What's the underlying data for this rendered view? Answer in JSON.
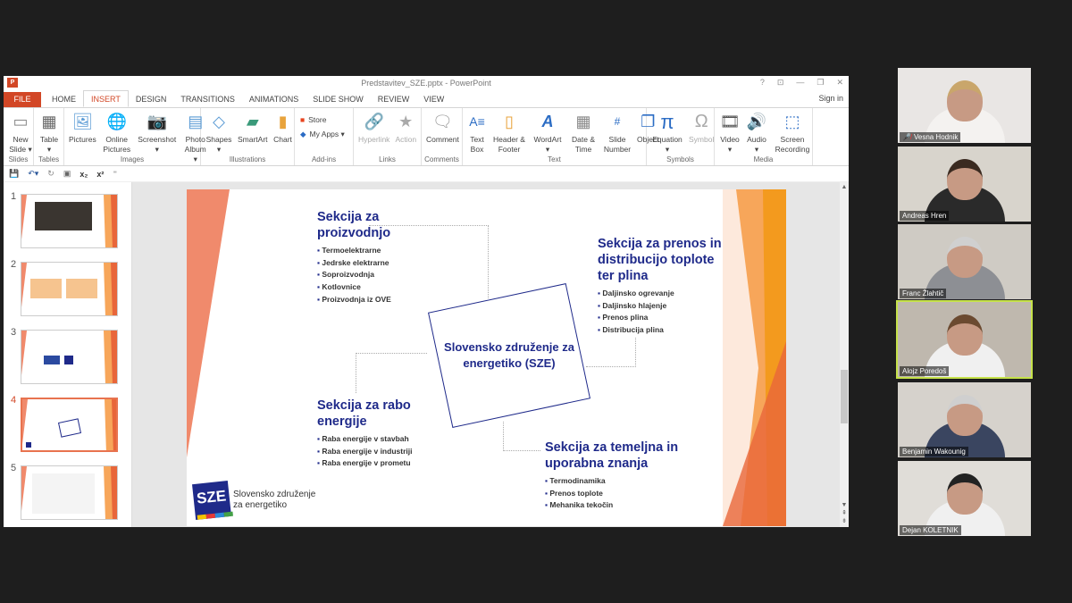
{
  "window": {
    "title": "Predstavitev_SZE.pptx - PowerPoint",
    "app_icon": "P",
    "controls": [
      "?",
      "⊡",
      "—",
      "❐",
      "✕"
    ],
    "sign_in": "Sign in"
  },
  "tabs": [
    {
      "label": "FILE"
    },
    {
      "label": "HOME"
    },
    {
      "label": "INSERT",
      "active": true
    },
    {
      "label": "DESIGN"
    },
    {
      "label": "TRANSITIONS"
    },
    {
      "label": "ANIMATIONS"
    },
    {
      "label": "SLIDE SHOW"
    },
    {
      "label": "REVIEW"
    },
    {
      "label": "VIEW"
    }
  ],
  "ribbon": {
    "slides": {
      "label": "Slides",
      "new_slide": "New Slide ▾"
    },
    "tables": {
      "label": "Tables",
      "table": "Table ▾"
    },
    "images": {
      "label": "Images",
      "pictures": "Pictures",
      "online_pictures": "Online Pictures",
      "screenshot": "Screenshot ▾",
      "photo_album": "Photo Album ▾"
    },
    "illustrations": {
      "label": "Illustrations",
      "shapes": "Shapes ▾",
      "smartart": "SmartArt",
      "chart": "Chart"
    },
    "addins": {
      "label": "Add-ins",
      "store": "Store",
      "my_apps": "My Apps ▾"
    },
    "links": {
      "label": "Links",
      "hyperlink": "Hyperlink",
      "action": "Action"
    },
    "comments": {
      "label": "Comments",
      "comment": "Comment"
    },
    "text": {
      "label": "Text",
      "text_box": "Text Box",
      "header_footer": "Header & Footer",
      "wordart": "WordArt ▾",
      "date_time": "Date & Time",
      "slide_number": "Slide Number",
      "object": "Object"
    },
    "symbols": {
      "label": "Symbols",
      "equation": "Equation ▾",
      "symbol": "Symbol"
    },
    "media": {
      "label": "Media",
      "video": "Video ▾",
      "audio": "Audio ▾",
      "screen_recording": "Screen Recording"
    }
  },
  "thumbnails": [
    {
      "number": "1"
    },
    {
      "number": "2"
    },
    {
      "number": "3"
    },
    {
      "number": "4",
      "selected": true
    },
    {
      "number": "5"
    }
  ],
  "slide": {
    "center": "Slovensko združenje za energetiko (SZE)",
    "sections": [
      {
        "title": "Sekcija za proizvodnjo",
        "items": [
          "Termoelektrarne",
          "Jedrske elektrarne",
          "Soproizvodnja",
          "Kotlovnice",
          "Proizvodnja iz OVE"
        ]
      },
      {
        "title": "Sekcija za prenos in distribucijo toplote ter plina",
        "items": [
          "Daljinsko ogrevanje",
          "Daljinsko hlajenje",
          "Prenos plina",
          "Distribucija plina"
        ]
      },
      {
        "title": "Sekcija za rabo energije",
        "items": [
          "Raba energije v stavbah",
          "Raba energije v industriji",
          "Raba energije v prometu"
        ]
      },
      {
        "title": "Sekcija za temeljna in uporabna znanja",
        "items": [
          "Termodinamika",
          "Prenos toplote",
          "Mehanika tekočin"
        ]
      }
    ],
    "logo": {
      "mark": "SZE",
      "text": "Slovensko združenje za energetiko"
    }
  },
  "participants": [
    {
      "name": "Vesna Hodnik",
      "muted": true
    },
    {
      "name": "Andreas Hren"
    },
    {
      "name": "Franc Žlahtič"
    },
    {
      "name": "Alojz Poredoš",
      "speaking": true
    },
    {
      "name": "Benjamin Wakounig"
    },
    {
      "name": "Dejan KOLETNIK"
    }
  ],
  "colors": {
    "accent": "#d24726",
    "slide_text": "#1f2a8a",
    "speaker_outline": "#c6e24a"
  }
}
